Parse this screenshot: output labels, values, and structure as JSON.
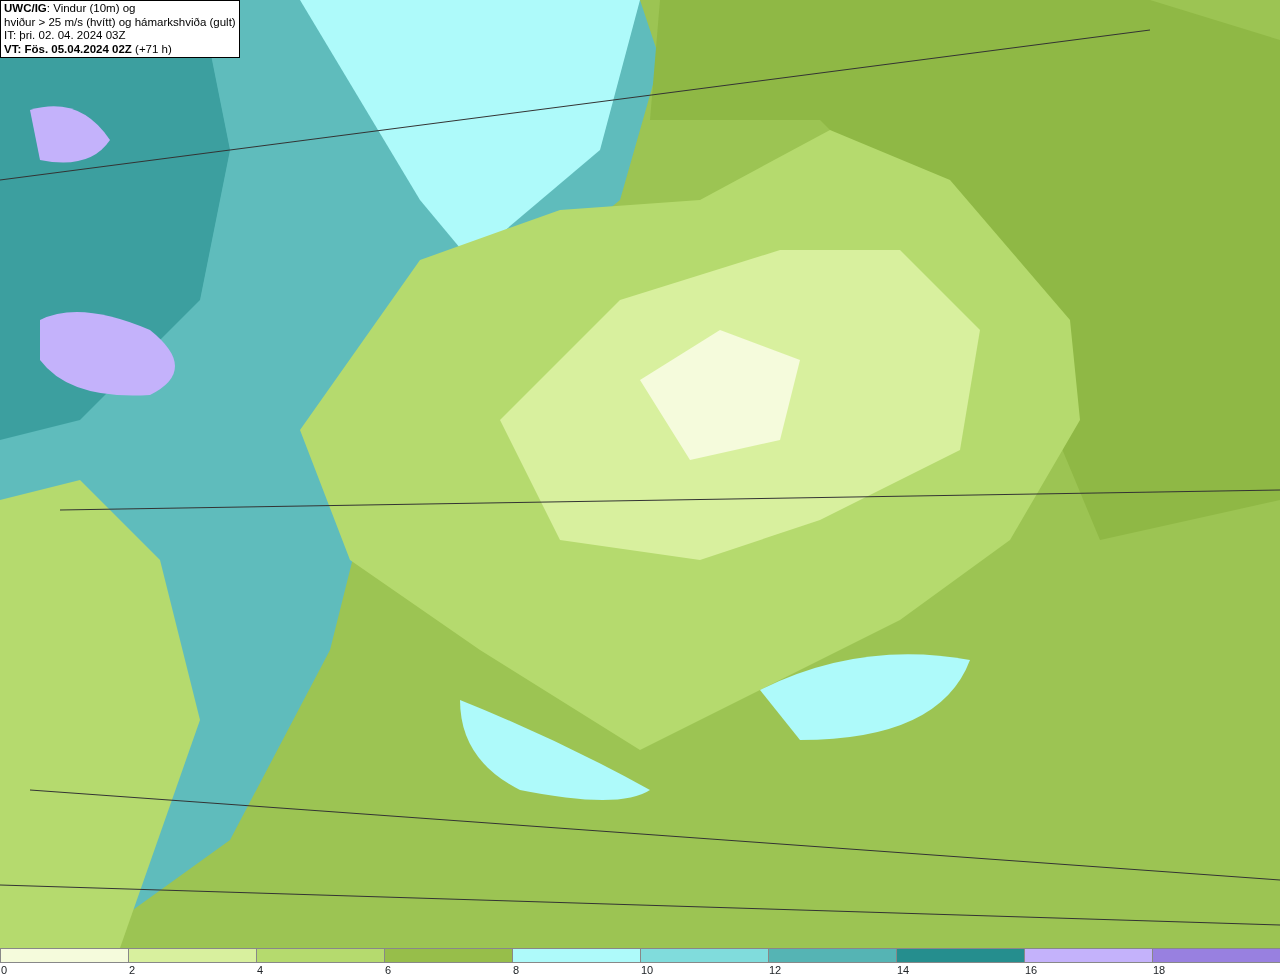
{
  "info_box": {
    "lines": [
      "**UWC/IG**: Vindur (10m) og",
      "hviður > 25 m/s (hvítt) og hámarkshviða (gult)",
      "IT: þri. 02. 04. 2024 03Z",
      "**VT: Fös. 05.04.2024 02Z** (+71 h)"
    ]
  },
  "legend": [
    {
      "label": "0",
      "color": "#f5fbdc"
    },
    {
      "label": "2",
      "color": "#d8f09e"
    },
    {
      "label": "4",
      "color": "#b5da6e"
    },
    {
      "label": "6",
      "color": "#97be4a"
    },
    {
      "label": "8",
      "color": "#aefafa"
    },
    {
      "label": "10",
      "color": "#80dcdc"
    },
    {
      "label": "12",
      "color": "#55b4b4"
    },
    {
      "label": "14",
      "color": "#258e8e"
    },
    {
      "label": "16",
      "color": "#c4b2fb"
    },
    {
      "label": "18",
      "color": "#9880e0"
    }
  ]
}
